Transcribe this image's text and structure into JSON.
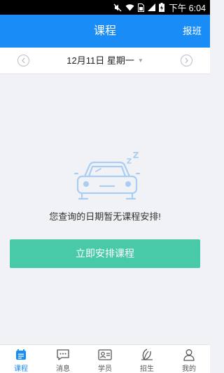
{
  "status_bar": {
    "time": "下午 6:04"
  },
  "header": {
    "title": "课程",
    "action_label": "报班"
  },
  "date_bar": {
    "date_text": "12月11日 星期一"
  },
  "empty_state": {
    "message": "您查询的日期暂无课程安排!",
    "cta_label": "立即安排课程"
  },
  "tabbar": {
    "items": [
      {
        "label": "课程",
        "icon": "calendar-icon",
        "active": true
      },
      {
        "label": "消息",
        "icon": "chat-icon",
        "active": false
      },
      {
        "label": "学员",
        "icon": "id-card-icon",
        "active": false
      },
      {
        "label": "招生",
        "icon": "leaf-icon",
        "active": false
      },
      {
        "label": "我的",
        "icon": "person-icon",
        "active": false
      }
    ]
  },
  "colors": {
    "primary": "#1a8cf6",
    "cta": "#48c9a8",
    "background": "#f1f2f6",
    "illustration": "#a9cdf3"
  }
}
